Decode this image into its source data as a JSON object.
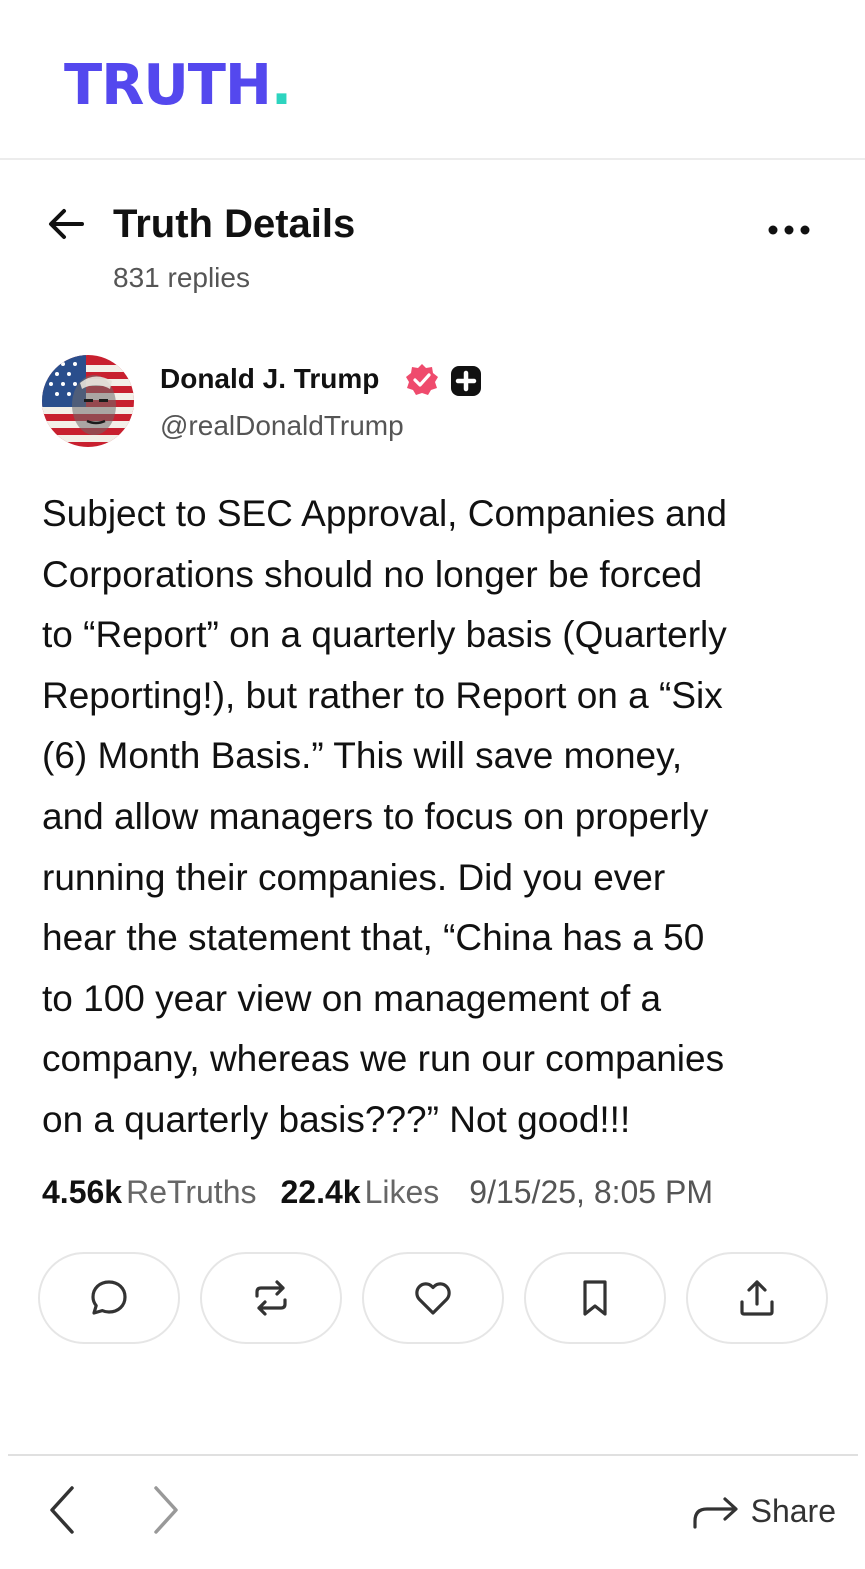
{
  "app": {
    "logo_text": "TRUTH",
    "logo_dot": ".",
    "brand_color": "#5448ee",
    "accent_color": "#2dd4bf"
  },
  "header": {
    "title": "Truth Details",
    "replies": "831 replies"
  },
  "post": {
    "author_name": "Donald J. Trump",
    "handle": "@realDonaldTrump",
    "verified_color": "#ef4b6d",
    "body": "Subject to SEC Approval, Companies and\nCorporations should no longer be forced\nto “Report” on a quarterly basis (Quarterly\nReporting!), but rather to Report on a “Six\n(6) Month Basis.” This will save money,\nand allow managers to focus on properly\nrunning their companies. Did you ever\nhear the statement that, “China has a 50\nto 100 year view on management of a\ncompany, whereas we run our companies\non a quarterly basis???” Not good!!!",
    "retruths_count": "4.56k",
    "retruths_label": "ReTruths",
    "likes_count": "22.4k",
    "likes_label": "Likes",
    "timestamp": "9/15/25, 8:05 PM"
  },
  "actions": [
    {
      "name": "reply",
      "icon": "comment-icon"
    },
    {
      "name": "retruth",
      "icon": "repost-icon"
    },
    {
      "name": "like",
      "icon": "heart-icon"
    },
    {
      "name": "bookmark",
      "icon": "bookmark-icon"
    },
    {
      "name": "share",
      "icon": "upload-icon"
    }
  ],
  "browser_bar": {
    "share_label": "Share"
  }
}
